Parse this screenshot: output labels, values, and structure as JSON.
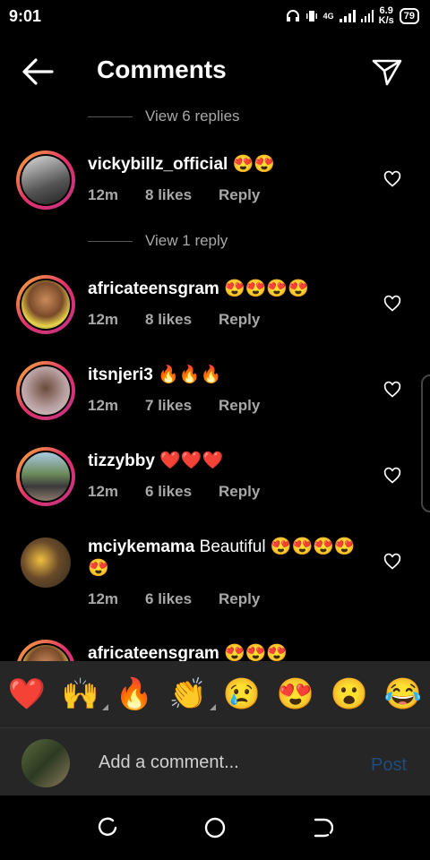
{
  "status": {
    "time": "9:01",
    "network": "4G",
    "speed_value": "6.9",
    "speed_unit": "K/s",
    "battery": "79"
  },
  "header": {
    "title": "Comments"
  },
  "replies_top": "View 6 replies",
  "replies_mid": "View 1 reply",
  "comments": [
    {
      "username": "vickybillz_official",
      "text": "😍😍",
      "time": "12m",
      "likes": "8 likes",
      "reply": "Reply"
    },
    {
      "username": "africateensgram",
      "text": "😍😍😍😍",
      "time": "12m",
      "likes": "8 likes",
      "reply": "Reply"
    },
    {
      "username": "itsnjeri3",
      "text": "🔥🔥🔥",
      "time": "12m",
      "likes": "7 likes",
      "reply": "Reply"
    },
    {
      "username": "tizzybby",
      "text": "❤️❤️❤️",
      "time": "12m",
      "likes": "6 likes",
      "reply": "Reply"
    },
    {
      "username": "mciykemama",
      "text": "Beautiful 😍😍😍😍😍",
      "time": "12m",
      "likes": "6 likes",
      "reply": "Reply"
    },
    {
      "username": "africateensgram",
      "text": "😍😍😍"
    }
  ],
  "emoji_bar": [
    "❤️",
    "🙌",
    "🔥",
    "👏",
    "😢",
    "😍",
    "😮",
    "😂"
  ],
  "input": {
    "placeholder": "Add a comment...",
    "post_label": "Post"
  },
  "colors": {
    "ring_start": "#f9b233",
    "ring_end": "#c13584",
    "post_disabled": "#1f4c7a",
    "bar_bg": "#262626"
  }
}
